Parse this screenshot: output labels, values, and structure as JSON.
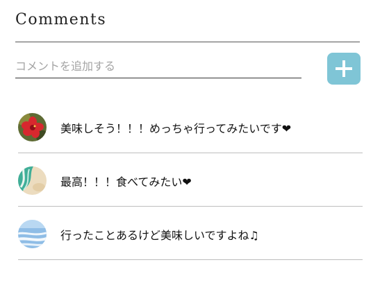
{
  "comments_section": {
    "title": "Comments",
    "input": {
      "placeholder": "コメントを追加する",
      "value": ""
    },
    "add_button_icon": "plus-icon",
    "accent_color": "#7fc5d6",
    "comments": [
      {
        "avatar": "hibiscus-avatar",
        "text": "美味しそう！！！めっちゃ行ってみたいです❤"
      },
      {
        "avatar": "beach-avatar",
        "text": "最高！！！食べてみたい❤"
      },
      {
        "avatar": "ocean-avatar",
        "text": "行ったことあるけど美味しいですよね♫"
      }
    ]
  }
}
